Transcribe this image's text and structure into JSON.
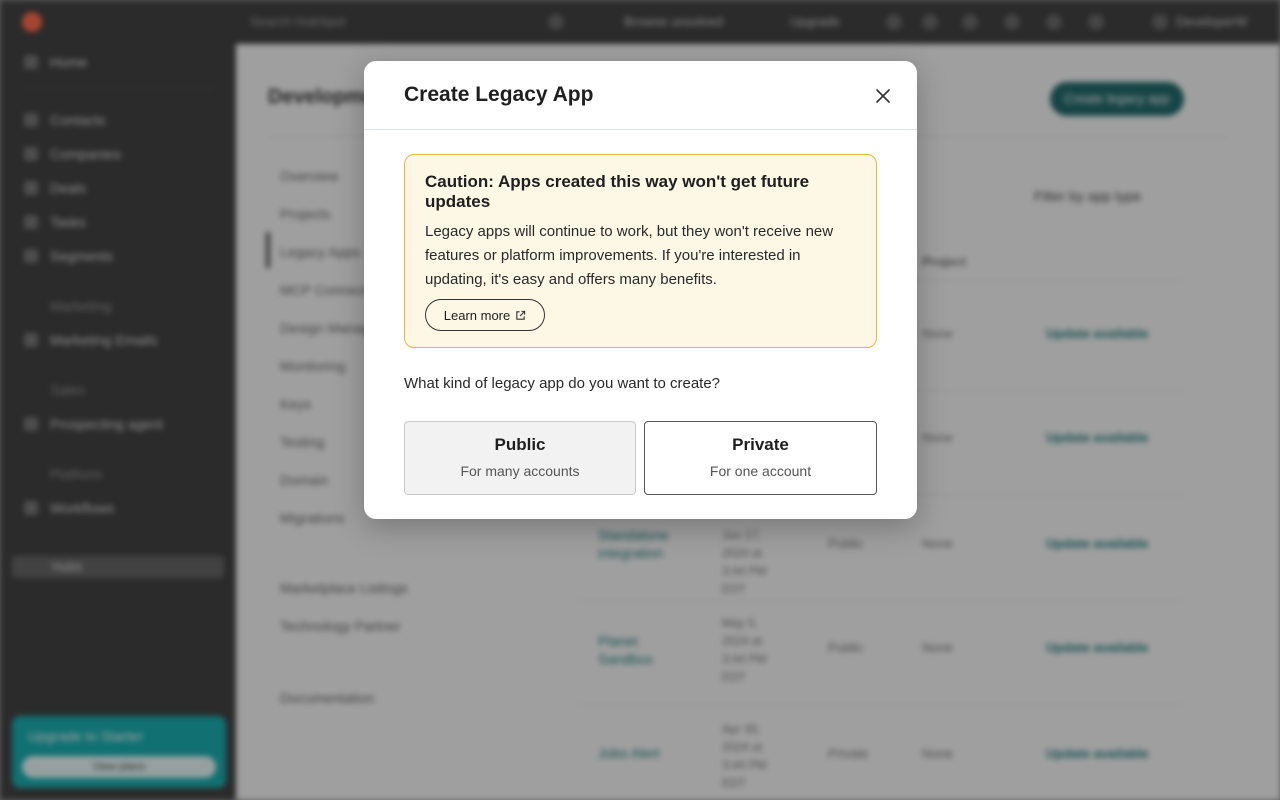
{
  "background": {
    "search_placeholder": "Search HubSpot",
    "top_actions": [
      "Browse unsolved",
      "Upgrade"
    ],
    "account_name": "DeveloperW",
    "sidebar": {
      "items": [
        {
          "label": "Home"
        },
        {
          "label": "Contacts"
        },
        {
          "label": "Companies"
        },
        {
          "label": "Deals"
        },
        {
          "label": "Tasks"
        },
        {
          "label": "Segments"
        },
        {
          "label": "Marketing"
        },
        {
          "label": "Marketing Emails"
        },
        {
          "label": "Sales"
        },
        {
          "label": "Prospecting agent"
        },
        {
          "label": "Platform"
        },
        {
          "label": "Workflows"
        }
      ],
      "pill_label": "Hubs",
      "upgrade_title": "Upgrade to Starter",
      "upgrade_button": "View plans"
    },
    "page_title": "Development",
    "primary_button": "Create legacy app",
    "subnav": [
      "Overview",
      "Projects",
      "Legacy Apps",
      "MCP Connector",
      "Design Manager",
      "Monitoring",
      "Keys",
      "Testing",
      "Domain",
      "Migrations",
      "Marketplace Listings",
      "Technology Partner",
      "Documentation"
    ],
    "filter_label": "Filter by app type",
    "column_header": "Project",
    "rows": [
      {
        "name": "",
        "date": "",
        "type": "",
        "project": "None",
        "status": "Update available"
      },
      {
        "name": "",
        "date": "",
        "type": "",
        "project": "None",
        "status": "Update available"
      },
      {
        "name": "Standalone integration",
        "date": "Jun 17, 2024 at 3:44 PM EDT",
        "type": "Public",
        "project": "None",
        "status": "Update available"
      },
      {
        "name": "Planet Sandbox",
        "date": "May 5, 2024 at 3:44 PM EDT",
        "type": "Public",
        "project": "None",
        "status": "Update available"
      },
      {
        "name": "Jobs Alert",
        "date": "Apr 30, 2024 at 3:44 PM EDT",
        "type": "Private",
        "project": "None",
        "status": "Update available"
      }
    ]
  },
  "modal": {
    "title": "Create Legacy App",
    "caution": {
      "title": "Caution: Apps created this way won't get future updates",
      "body": "Legacy apps will continue to work, but they won't receive new features or platform improvements. If you're interested in updating, it's easy and offers many benefits.",
      "learn_more": "Learn more"
    },
    "question": "What kind of legacy app do you want to create?",
    "options": [
      {
        "title": "Public",
        "subtitle": "For many accounts",
        "selected": true
      },
      {
        "title": "Private",
        "subtitle": "For one account",
        "selected": false
      }
    ]
  },
  "colors": {
    "caution_bg": "#fdf7e5",
    "caution_border": "#e5b83d",
    "brand_teal": "#00a4a6",
    "brand_orange": "#ff5c35"
  }
}
